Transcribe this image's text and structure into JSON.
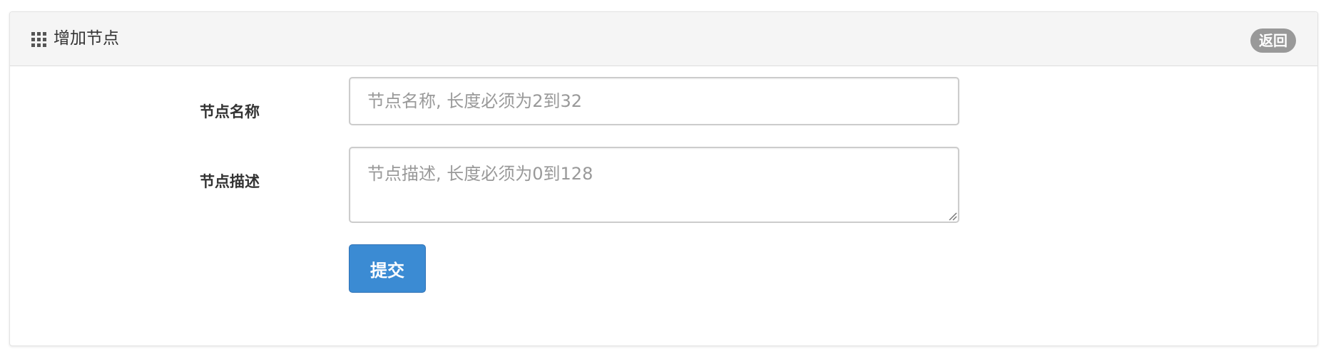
{
  "panel": {
    "title": "增加节点",
    "title_icon": "grid-icon",
    "back_label": "返回"
  },
  "form": {
    "name": {
      "label": "节点名称",
      "value": "",
      "placeholder": "节点名称, 长度必须为2到32"
    },
    "description": {
      "label": "节点描述",
      "value": "",
      "placeholder": "节点描述, 长度必须为0到128"
    },
    "submit_label": "提交"
  },
  "colors": {
    "primary_button": "#3b8bd3",
    "badge": "#999999",
    "heading_bg": "#f5f5f5"
  }
}
